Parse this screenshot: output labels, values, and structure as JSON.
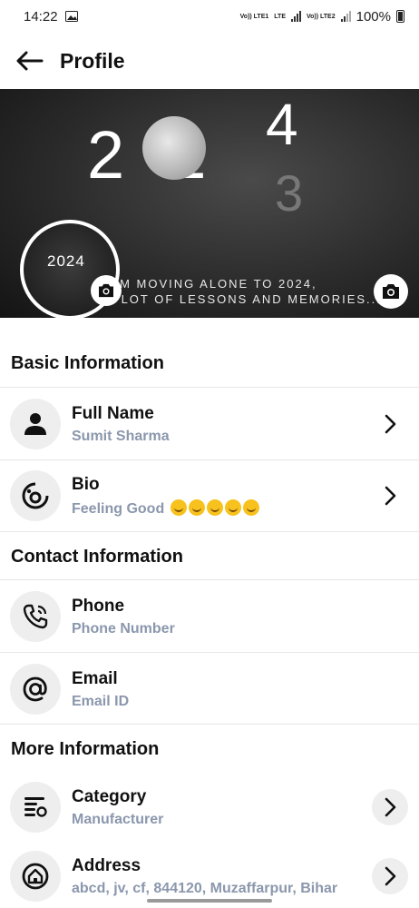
{
  "status": {
    "time": "14:22",
    "battery": "100%",
    "sim1": "Vo)) LTE1",
    "sim1_data": "LTE",
    "sim2": "Vo)) LTE2"
  },
  "header": {
    "title": "Profile"
  },
  "cover": {
    "year": "2024",
    "digit_top": "4",
    "digit_bottom": "3",
    "line1": "I'M MOVING ALONE TO 2024,",
    "line2": "A LOT OF LESSONS AND MEMORIES..."
  },
  "sections": {
    "basic": "Basic Information",
    "contact": "Contact Information",
    "more": "More Information"
  },
  "fields": {
    "full_name": {
      "label": "Full Name",
      "value": "Sumit Sharma"
    },
    "bio": {
      "label": "Bio",
      "value": "Feeling Good"
    },
    "phone": {
      "label": "Phone",
      "value": "Phone Number"
    },
    "email": {
      "label": "Email",
      "value": "Email ID"
    },
    "category": {
      "label": "Category",
      "value": "Manufacturer"
    },
    "address": {
      "label": "Address",
      "value": "abcd, jv, cf, 844120, Muzaffarpur, Bihar"
    }
  },
  "icons": [
    "back-arrow-icon",
    "camera-icon",
    "person-icon",
    "bio-icon",
    "phone-icon",
    "at-icon",
    "category-icon",
    "home-icon",
    "chevron-right-icon"
  ]
}
